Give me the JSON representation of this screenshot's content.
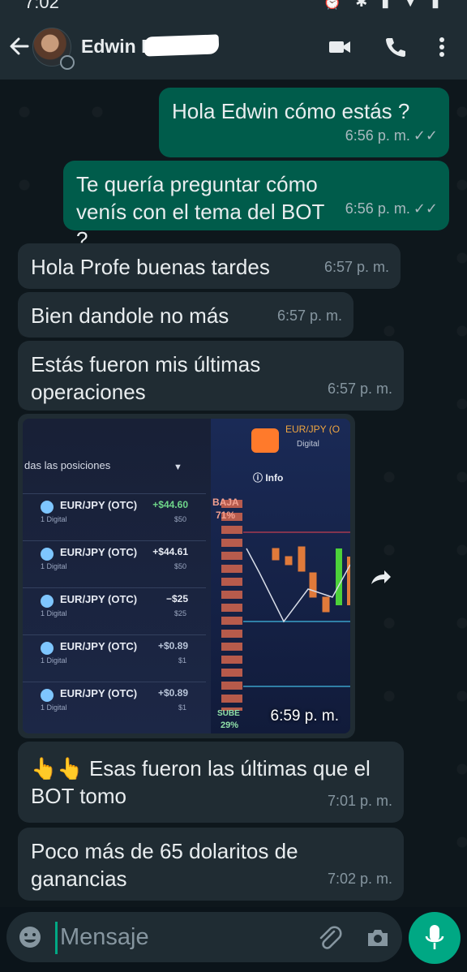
{
  "status_bar": {
    "time": "7:02"
  },
  "header": {
    "contact_name": "Edwin Ed"
  },
  "messages": [
    {
      "dir": "out",
      "text": "Hola Edwin cómo estás ?",
      "time": "6:56 p. m."
    },
    {
      "dir": "out",
      "text": "Te quería preguntar cómo venís con el tema del BOT ?",
      "time": "6:56 p. m."
    },
    {
      "dir": "in",
      "text": "Hola Profe buenas tardes",
      "time": "6:57 p. m."
    },
    {
      "dir": "in",
      "text": "Bien dandole no más",
      "time": "6:57 p. m."
    },
    {
      "dir": "in",
      "text": "Estás fueron mis últimas operaciones",
      "time": "6:57 p. m."
    },
    {
      "dir": "in",
      "text": "👆👆 Esas fueron las últimas que el BOT tomo",
      "time": "7:01 p. m."
    },
    {
      "dir": "in",
      "text": "Poco más de 65 dolaritos de ganancias",
      "time": "7:02 p. m."
    }
  ],
  "image_message": {
    "time": "6:59 p. m.",
    "panel_title": "das las posiciones",
    "positions": [
      {
        "pair": "EUR/JPY (OTC)",
        "sub": "1 Digital",
        "pl": "+$44.60",
        "amount": "$50"
      },
      {
        "pair": "EUR/JPY (OTC)",
        "sub": "1 Digital",
        "pl": "+$44.61",
        "amount": "$50"
      },
      {
        "pair": "EUR/JPY (OTC)",
        "sub": "1 Digital",
        "pl": "−$25",
        "amount": "$25"
      },
      {
        "pair": "EUR/JPY (OTC)",
        "sub": "1 Digital",
        "pl": "+$0.89",
        "amount": "$1"
      },
      {
        "pair": "EUR/JPY (OTC)",
        "sub": "1 Digital",
        "pl": "+$0.89",
        "amount": "$1"
      }
    ],
    "chart_pair": "EUR/JPY (O",
    "chart_sub": "Digital",
    "info_label": "Info",
    "baja_label": "BAJA",
    "baja_pct": "71%",
    "sube_label": "SUBE",
    "sube_pct": "29%"
  },
  "input": {
    "placeholder": "Mensaje"
  },
  "colors": {
    "accent": "#00a884",
    "outgoing_bubble": "#005c4b",
    "incoming_bubble": "#202c33"
  }
}
